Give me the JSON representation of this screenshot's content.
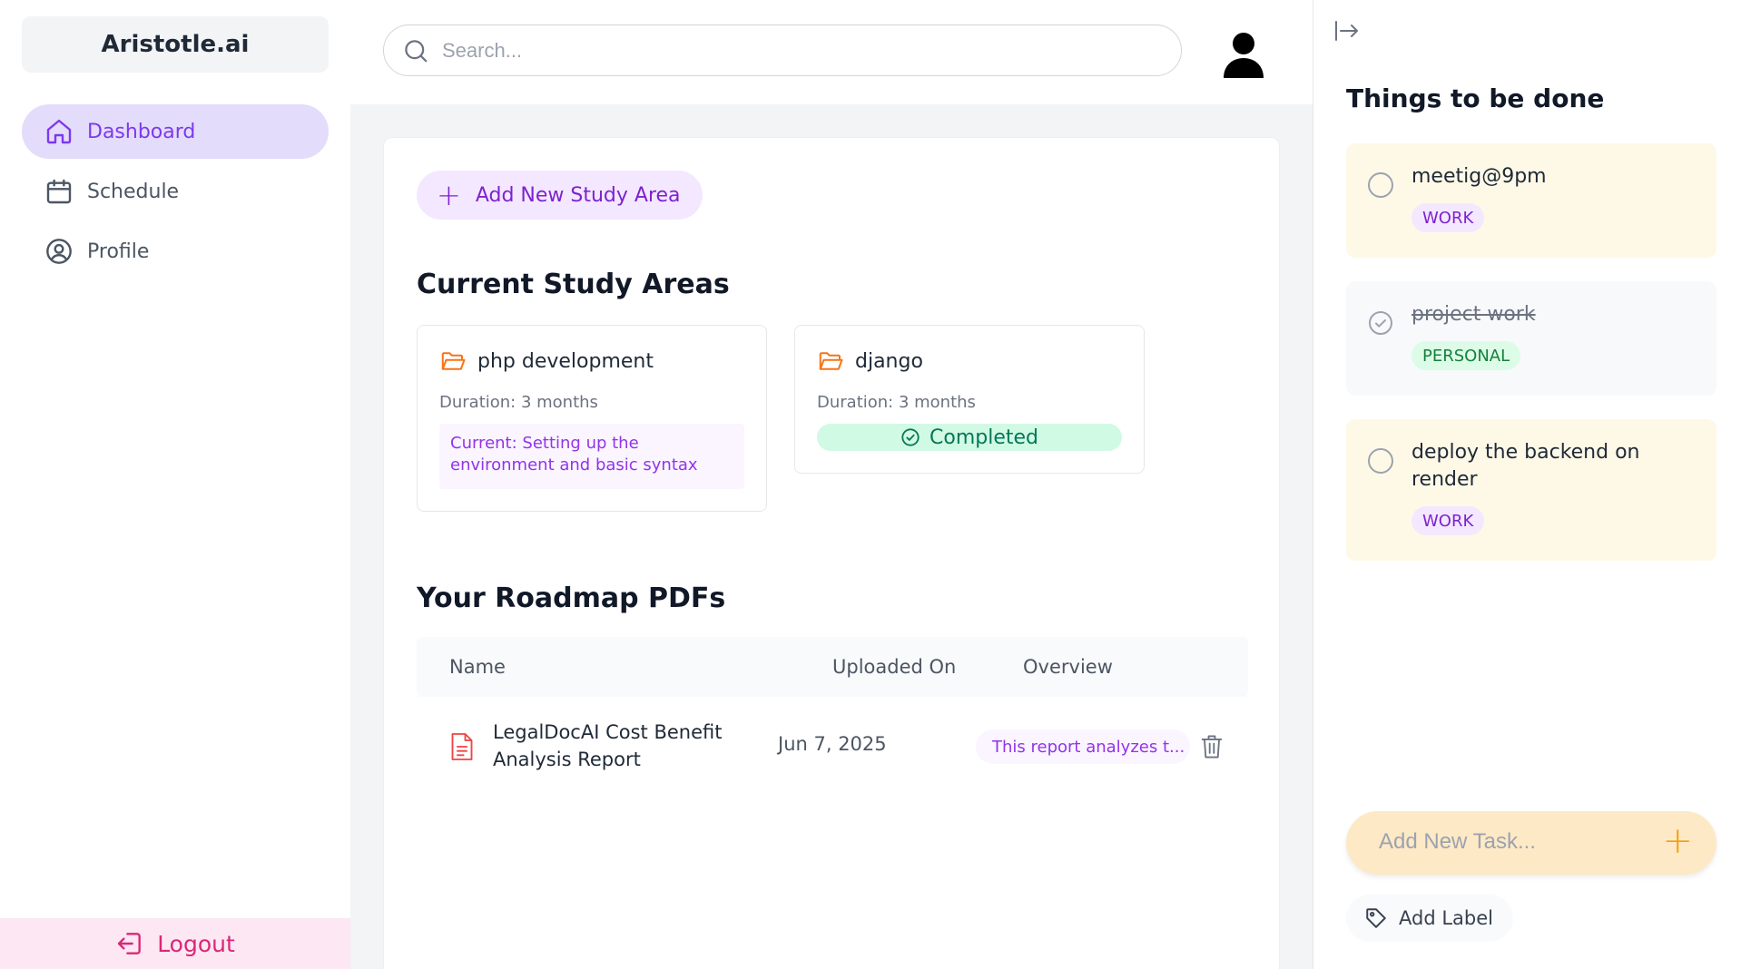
{
  "brand": {
    "name": "Aristotle.ai"
  },
  "sidebar": {
    "items": [
      {
        "label": "Dashboard",
        "icon": "home-icon",
        "active": true
      },
      {
        "label": "Schedule",
        "icon": "calendar-icon",
        "active": false
      },
      {
        "label": "Profile",
        "icon": "user-circle-icon",
        "active": false
      }
    ],
    "logout_label": "Logout"
  },
  "search": {
    "placeholder": "Search...",
    "value": ""
  },
  "main": {
    "add_study_area_label": "Add New Study Area",
    "current_heading": "Current Study Areas",
    "study_areas": [
      {
        "title": "php development",
        "duration": "Duration: 3 months",
        "current": "Current: Setting up the environment and basic syntax"
      },
      {
        "title": "django",
        "duration": "Duration: 3 months",
        "status": "Completed"
      }
    ],
    "roadmap_heading": "Your Roadmap PDFs",
    "table": {
      "columns": [
        "Name",
        "Uploaded On",
        "Overview"
      ],
      "rows": [
        {
          "name": "LegalDocAI Cost Benefit Analysis Report",
          "uploaded": "Jun 7, 2025",
          "overview": "This report analyzes t..."
        }
      ]
    }
  },
  "tasks_panel": {
    "title": "Things to be done",
    "tasks": [
      {
        "text": "meetig@9pm",
        "label": "WORK",
        "done": false
      },
      {
        "text": "project work",
        "label": "PERSONAL",
        "done": true
      },
      {
        "text": "deploy the backend on render",
        "label": "WORK",
        "done": false
      }
    ],
    "add_task_placeholder": "Add New Task...",
    "add_label": "Add Label"
  },
  "colors": {
    "accent": "#7c3aed",
    "active_nav_bg": "#e4dcfb",
    "logout": "#db2777",
    "task_work_bg": "#fef9e7",
    "task_personal_bg": "#f8f9fb",
    "completed": "#047857"
  }
}
